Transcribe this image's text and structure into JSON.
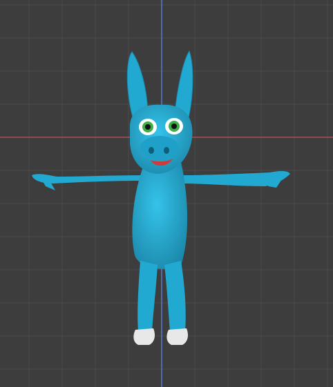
{
  "viewport": {
    "name": "3D Viewport",
    "background_color": "#3d3d3d",
    "grid": {
      "visible": true,
      "line_color": "#4b4b4b",
      "x_axis_color": "#b04b55",
      "z_axis_color": "#5a7bd0"
    },
    "model": {
      "body_color": "#22a9d2",
      "shadow_color": "#1a86a8",
      "hoof_color": "#e8e8e8",
      "eye_iris_color": "#3fae4a",
      "tongue_color": "#d23a3a",
      "icons": [
        "character-model-icon"
      ]
    }
  }
}
